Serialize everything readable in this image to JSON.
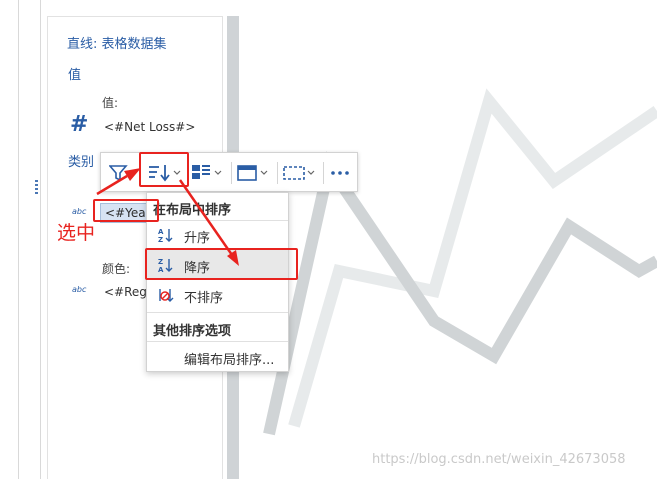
{
  "panel": {
    "title": "直线: 表格数据集",
    "value_section": "值",
    "value_label": "值:",
    "value_field": "<#Net Loss#>",
    "category_section": "类别",
    "category_chip": "<#Years#>",
    "color_label": "颜色:",
    "color_field": "<#Region#>",
    "abc_badge_1": "abc",
    "abc_badge_2": "abc",
    "hash_icon": "#"
  },
  "toolbar": {
    "icons": [
      "filter-icon",
      "sort-icon",
      "layout-icon",
      "container-icon",
      "select-icon",
      "more-icon"
    ]
  },
  "sort_menu": {
    "header_layout": "在布局中排序",
    "ascending": "升序",
    "descending": "降序",
    "no_sort": "不排序",
    "header_other": "其他排序选项",
    "edit_layout_sort": "编辑布局排序..."
  },
  "annotations": {
    "select_label": "选中",
    "color": "#e8231f"
  },
  "watermark": "https://blog.csdn.net/weixin_42673058",
  "colors": {
    "accent": "#2a5da5",
    "chip_bg": "#d7e3f3",
    "chart_line_light": "#e7eaeb",
    "chart_line_dark": "#d0d4d6"
  }
}
